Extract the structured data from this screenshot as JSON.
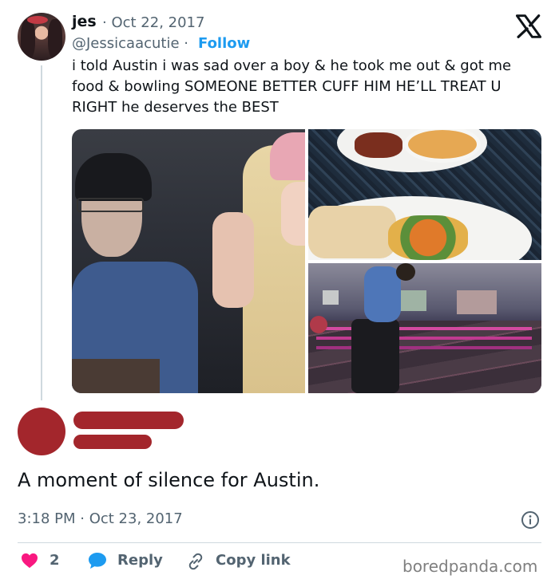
{
  "tweet": {
    "name": "jes",
    "date": "· Oct 22, 2017",
    "handle": "@Jessicaacutie ·",
    "follow_label": "Follow",
    "text_lines": [
      "i told Austin i was sad over a boy & he took me out & got me",
      "food & bowling SOMEONE BETTER CUFF HIM HE’LL TREAT U",
      "RIGHT he deserves the BEST"
    ]
  },
  "reply": {
    "text": "A moment of silence for  Austin.",
    "timestamp": "3:18 PM · Oct 23, 2017"
  },
  "actions": {
    "like_count": "2",
    "reply_label": "Reply",
    "copy_link_label": "Copy link"
  },
  "watermark": "boredpanda.com",
  "colors": {
    "accent": "#1d9bf0",
    "heart": "#f91880",
    "redaction": "#a3262c",
    "muted_text": "#536471"
  },
  "icons": [
    "x-logo-icon",
    "info-icon",
    "heart-icon",
    "reply-bubble-icon",
    "link-icon"
  ]
}
